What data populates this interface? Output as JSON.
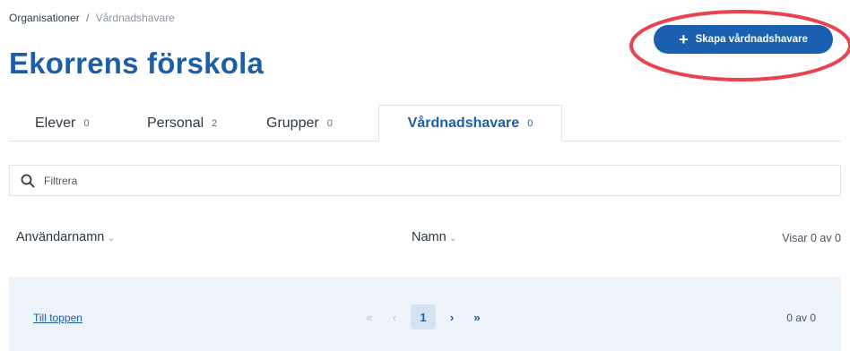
{
  "breadcrumb": {
    "parent": "Organisationer",
    "separator": "/",
    "current": "Vårdnadshavare"
  },
  "page": {
    "title": "Ekorrens förskola"
  },
  "actions": {
    "create_label": "Skapa vårdnadshavare",
    "create_icon": "plus-icon"
  },
  "annotation": {
    "color": "#e8434f"
  },
  "tabs": [
    {
      "label": "Elever",
      "count": "0"
    },
    {
      "label": "Personal",
      "count": "2"
    },
    {
      "label": "Grupper",
      "count": "0"
    },
    {
      "label": "Vårdnadshavare",
      "count": "0",
      "active": true
    }
  ],
  "filter": {
    "placeholder": "Filtrera",
    "value": "",
    "icon": "search-icon"
  },
  "table": {
    "columns": [
      {
        "label": "Användarnamn"
      },
      {
        "label": "Namn"
      }
    ],
    "sort_icon": "chevron-down-icon",
    "showing": "Visar 0 av 0"
  },
  "footer": {
    "to_top": "Till toppen",
    "pagination": {
      "first": "«",
      "prev": "‹",
      "current": "1",
      "next": "›",
      "last": "»"
    },
    "count": "0 av 0"
  },
  "colors": {
    "brand": "#1d5ea8",
    "button": "#1b5fb0",
    "footer_bg": "#edf3f8"
  }
}
